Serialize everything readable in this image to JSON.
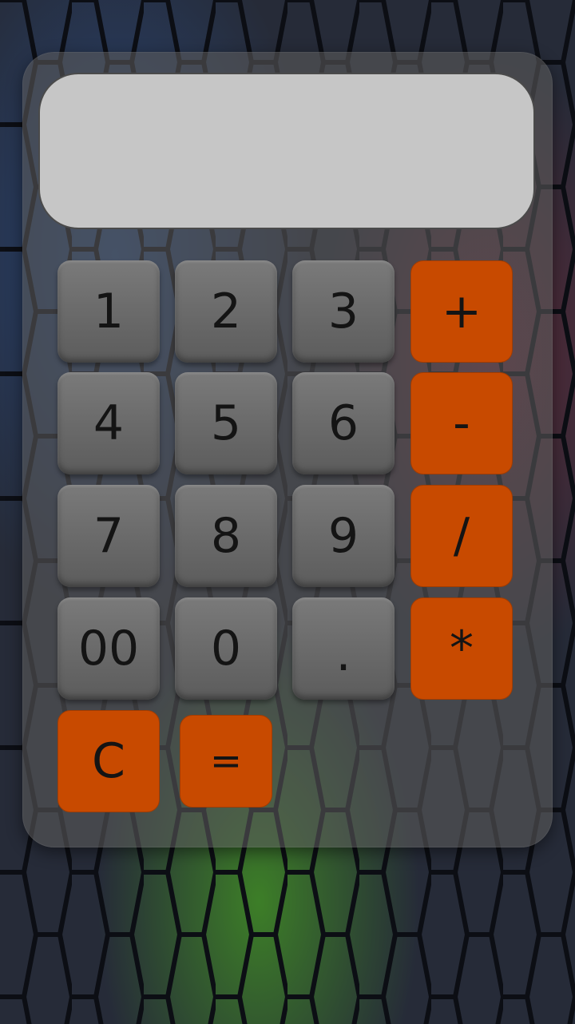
{
  "display": {
    "value": ""
  },
  "keys": {
    "k1": "1",
    "k2": "2",
    "k3": "3",
    "plus": "+",
    "k4": "4",
    "k5": "5",
    "k6": "6",
    "minus": "-",
    "k7": "7",
    "k8": "8",
    "k9": "9",
    "divide": "/",
    "k00": "00",
    "k0": "0",
    "dot": ".",
    "multiply": "*",
    "clear": "C",
    "equals": "="
  },
  "colors": {
    "operator": "#c84a00",
    "digit": "#6c6c6c",
    "display": "#c6c6c6"
  }
}
